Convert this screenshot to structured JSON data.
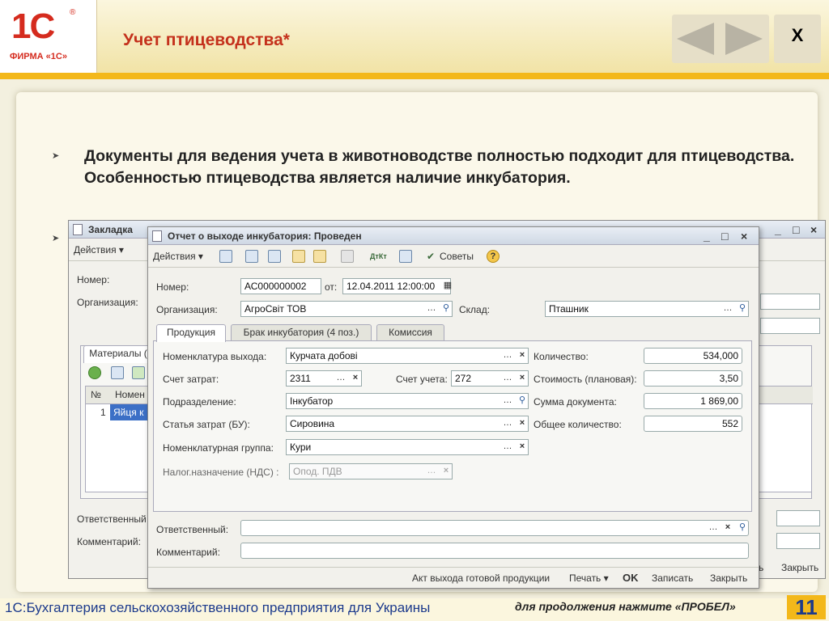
{
  "header": {
    "logo_mark": "1С",
    "logo_reg": "®",
    "logo_firm": "ФИРМА «1С»",
    "title": "Учет птицеводства*",
    "close_label": "X"
  },
  "bullets": {
    "marker": "➤",
    "text": "Документы для ведения учета в животноводстве полностью подходит для птицеводства. Особенностью птицеводства является наличие инкубатория."
  },
  "back_window": {
    "title": "Закладка",
    "actions_label": "Действия ▾",
    "number_label": "Номер:",
    "org_label": "Организация:",
    "materials_tab": "Материалы (",
    "col_no": "№",
    "col_name": "Номен",
    "row1_no": "1",
    "row1_name": "Яйця к",
    "responsible_label": "Ответственный",
    "comment_label": "Комментарий:",
    "btn_close_partial": "ь",
    "btn_close": "Закрыть"
  },
  "front_window": {
    "title": "Отчет о выходе инкубатория: Проведен",
    "toolbar": {
      "actions": "Действия ▾",
      "dtkt": "ДтКт",
      "advices": "Советы"
    },
    "number_label": "Номер:",
    "number_value": "АС000000002",
    "date_label": "от:",
    "date_value": "12.04.2011 12:00:00",
    "org_label": "Организация:",
    "org_value": "АгроСвіт ТОВ",
    "warehouse_label": "Склад:",
    "warehouse_value": "Пташник",
    "tabs": [
      "Продукция",
      "Брак инкубатория (4 поз.)",
      "Комиссия"
    ],
    "fields": {
      "nomenclature_label": "Номенклатура выхода:",
      "nomenclature_value": "Курчата добові",
      "cost_account_label": "Счет затрат:",
      "cost_account_value": "2311",
      "account_label": "Счет учета:",
      "account_value": "272",
      "division_label": "Подразделение:",
      "division_value": "Інкубатор",
      "cost_item_label": "Статья затрат (БУ):",
      "cost_item_value": "Сировина",
      "group_label": "Номенклатурная группа:",
      "group_value": "Кури",
      "tax_label": "Налог.назначение (НДС) :",
      "tax_value": "Опод. ПДВ",
      "qty_label": "Количество:",
      "qty_value": "534,000",
      "planned_cost_label": "Стоимость (плановая):",
      "planned_cost_value": "3,50",
      "doc_sum_label": "Сумма документа:",
      "doc_sum_value": "1 869,00",
      "total_qty_label": "Общее количество:",
      "total_qty_value": "552"
    },
    "responsible_label": "Ответственный:",
    "comment_label": "Комментарий:",
    "bottom_buttons": {
      "act": "Акт выхода готовой продукции",
      "print": "Печать ▾",
      "ok": "OK",
      "save": "Записать",
      "close": "Закрыть"
    }
  },
  "footer": {
    "title": "1С:Бухгалтерия сельскохозяйственного предприятия для Украины",
    "hint": "для продолжения нажмите «ПРОБЕЛ»",
    "page": "11"
  }
}
